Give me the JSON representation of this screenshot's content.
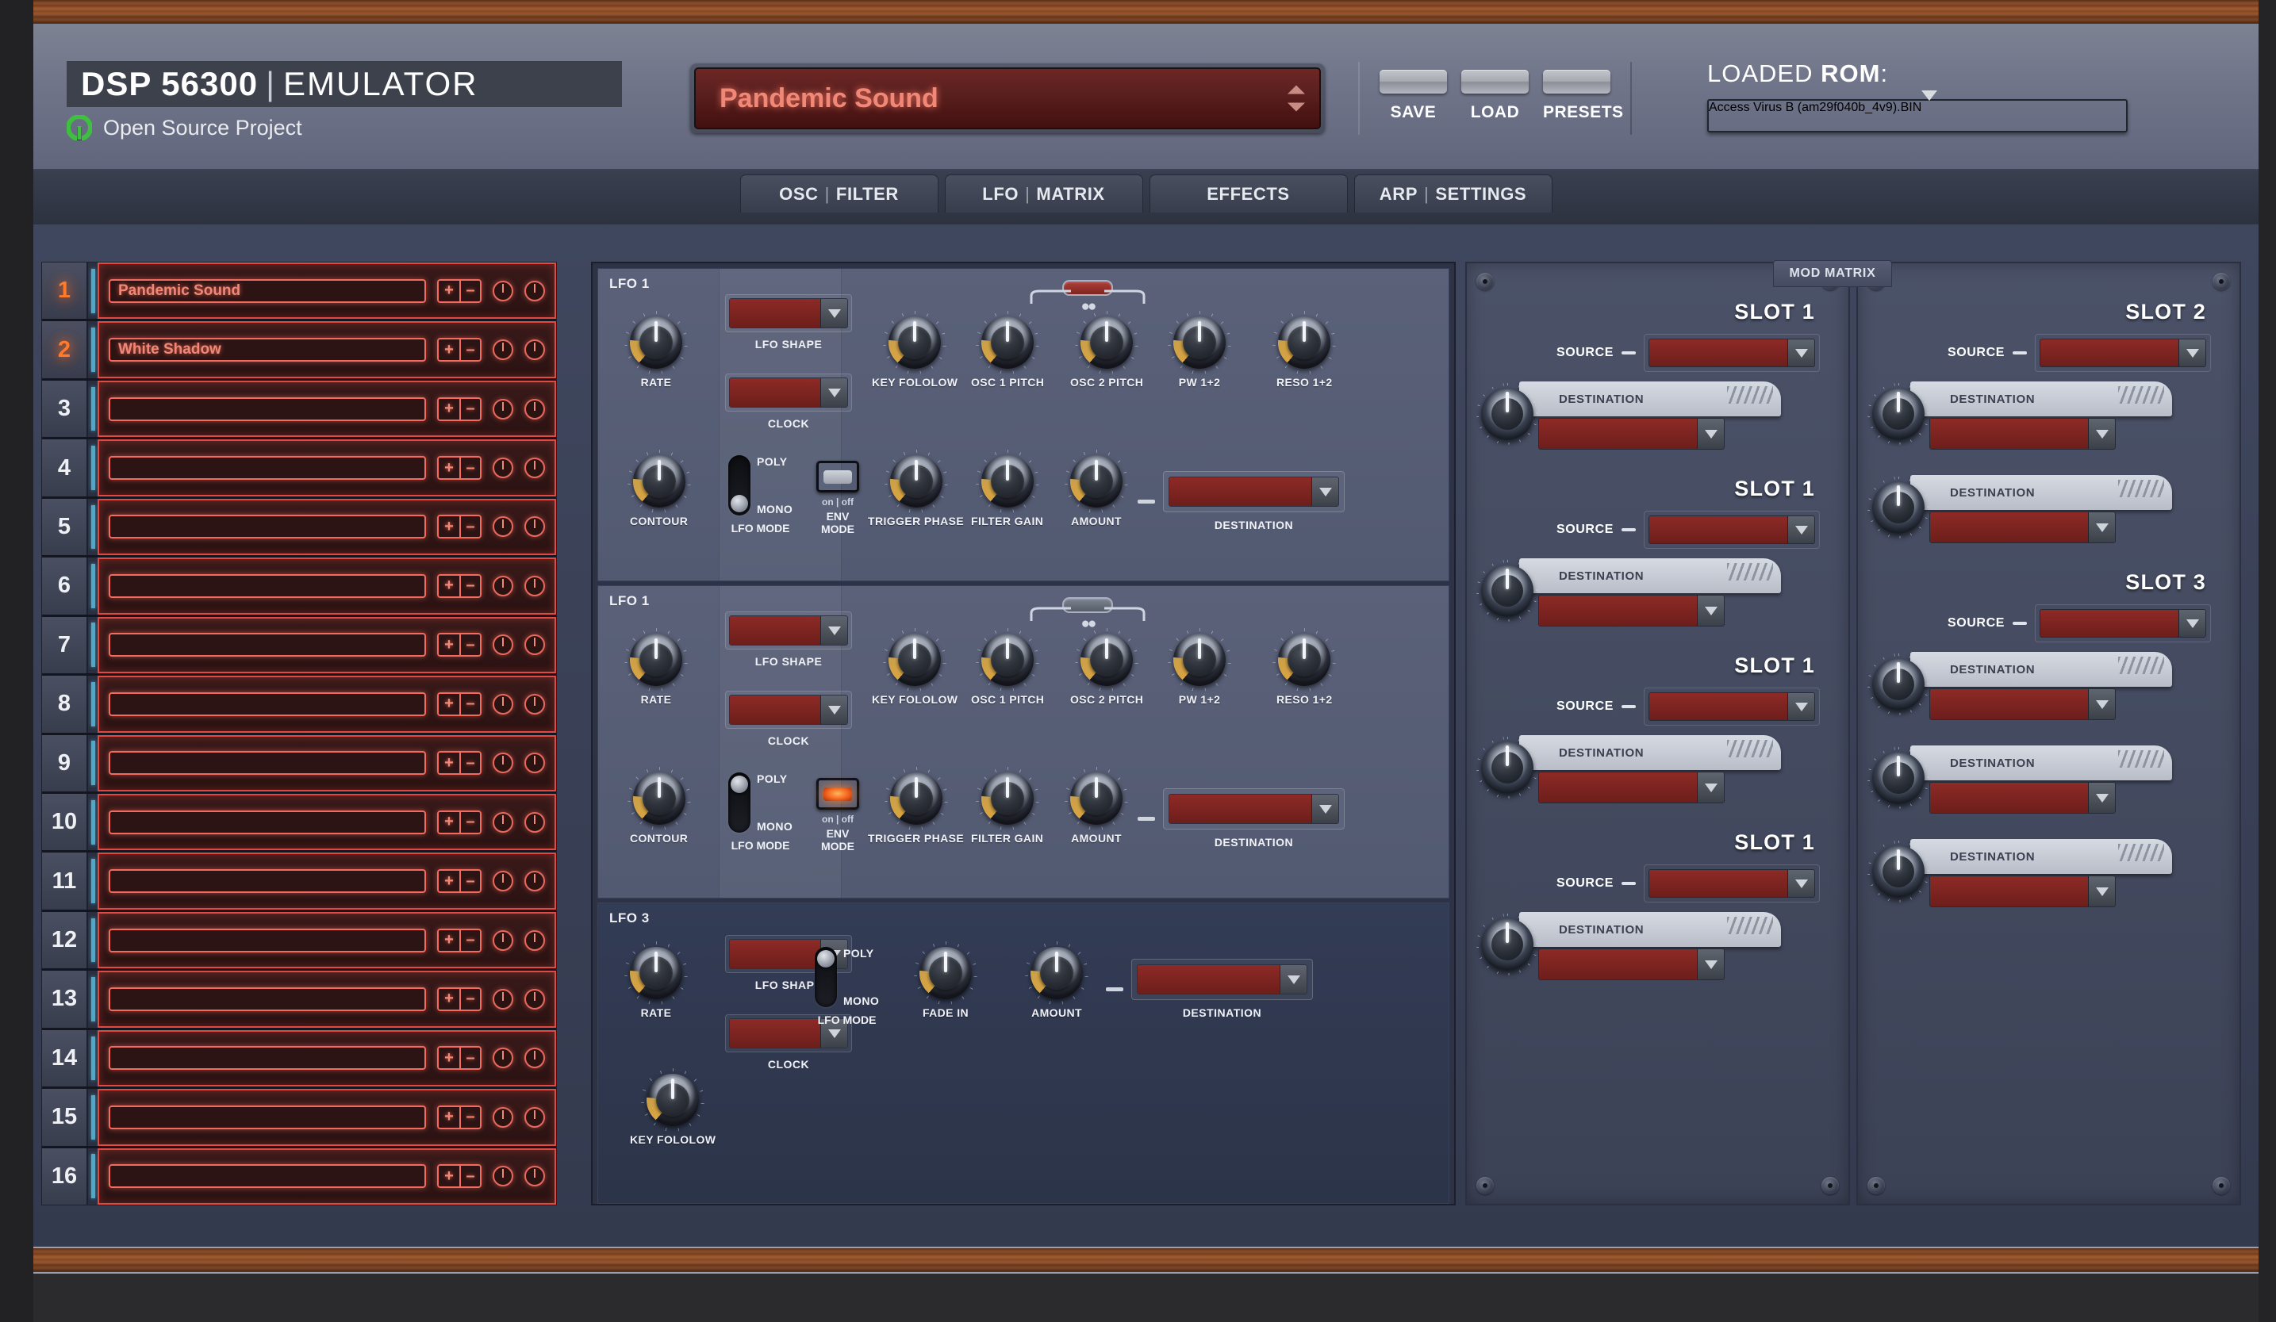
{
  "app": {
    "logo_main": "DSP 56300",
    "logo_sep": "|",
    "logo_sub": "EMULATOR",
    "open_source": "Open Source Project"
  },
  "header": {
    "patch_name": "Pandemic Sound",
    "buttons": [
      {
        "label": "SAVE",
        "name": "save-button"
      },
      {
        "label": "LOAD",
        "name": "load-button"
      },
      {
        "label": "PRESETS",
        "name": "presets-button"
      }
    ],
    "rom_label_a": "LOADED ",
    "rom_label_b": "ROM",
    "rom_label_c": ":",
    "rom_value": "Access Virus B (am29f040b_4v9).BIN"
  },
  "tabs": [
    {
      "left": "OSC",
      "right": "FILTER",
      "active": false
    },
    {
      "left": "LFO",
      "right": "MATRIX",
      "active": true
    },
    {
      "left": "EFFECTS",
      "right": "",
      "active": false
    },
    {
      "left": "ARP",
      "right": "SETTINGS",
      "active": false
    }
  ],
  "patch_list": {
    "plus_label": "+",
    "minus_label": "–",
    "rows": [
      {
        "num": "1",
        "name": "Pandemic Sound",
        "lit": true
      },
      {
        "num": "2",
        "name": "White Shadow",
        "lit": true
      },
      {
        "num": "3",
        "name": "",
        "lit": false
      },
      {
        "num": "4",
        "name": "",
        "lit": false
      },
      {
        "num": "5",
        "name": "",
        "lit": false
      },
      {
        "num": "6",
        "name": "",
        "lit": false
      },
      {
        "num": "7",
        "name": "",
        "lit": false
      },
      {
        "num": "8",
        "name": "",
        "lit": false
      },
      {
        "num": "9",
        "name": "",
        "lit": false
      },
      {
        "num": "10",
        "name": "",
        "lit": false
      },
      {
        "num": "11",
        "name": "",
        "lit": false
      },
      {
        "num": "12",
        "name": "",
        "lit": false
      },
      {
        "num": "13",
        "name": "",
        "lit": false
      },
      {
        "num": "14",
        "name": "",
        "lit": false
      },
      {
        "num": "15",
        "name": "",
        "lit": false
      },
      {
        "num": "16",
        "name": "",
        "lit": false
      }
    ]
  },
  "lfo1": {
    "title": "LFO 1",
    "rate": "RATE",
    "contour": "CONTOUR",
    "shape": "LFO SHAPE",
    "clock": "CLOCK",
    "mode": "LFO MODE",
    "mode_poly": "POLY",
    "mode_mono": "MONO",
    "mode_state": "mono",
    "env_sub": "on | off",
    "env_cap_a": "ENV",
    "env_cap_b": "MODE",
    "env_state": "off",
    "key_fololow": "KEY FOLOLOW",
    "osc1_pitch": "OSC 1 PITCH",
    "osc2_pitch": "OSC 2 PITCH",
    "pw": "PW 1+2",
    "reso": "RESO 1+2",
    "trigger_phase": "TRIGGER PHASE",
    "filter_gain": "FILTER GAIN",
    "amount": "AMOUNT",
    "destination": "DESTINATION"
  },
  "lfo2": {
    "title": "LFO 1",
    "rate": "RATE",
    "contour": "CONTOUR",
    "shape": "LFO SHAPE",
    "clock": "CLOCK",
    "mode": "LFO MODE",
    "mode_poly": "POLY",
    "mode_mono": "MONO",
    "mode_state": "poly",
    "env_sub": "on | off",
    "env_cap_a": "ENV",
    "env_cap_b": "MODE",
    "env_state": "on",
    "key_fololow": "KEY FOLOLOW",
    "osc1_pitch": "OSC 1 PITCH",
    "osc2_pitch": "OSC 2 PITCH",
    "pw": "PW 1+2",
    "reso": "RESO 1+2",
    "trigger_phase": "TRIGGER PHASE",
    "filter_gain": "FILTER GAIN",
    "amount": "AMOUNT",
    "destination": "DESTINATION"
  },
  "lfo3": {
    "title": "LFO 3",
    "rate": "RATE",
    "key_fololow": "KEY FOLOLOW",
    "shape": "LFO SHAPE",
    "clock": "CLOCK",
    "mode": "LFO MODE",
    "mode_poly": "POLY",
    "mode_mono": "MONO",
    "mode_state": "poly",
    "fade_in": "FADE IN",
    "amount": "AMOUNT",
    "destination": "DESTINATION"
  },
  "mod_matrix": {
    "tab_label": "MOD MATRIX",
    "source_label": "SOURCE",
    "destination_label": "DESTINATION",
    "left_column": [
      {
        "slot": "SLOT 1",
        "destinations": 1
      },
      {
        "slot": "SLOT 1",
        "destinations": 1
      },
      {
        "slot": "SLOT 1",
        "destinations": 1
      },
      {
        "slot": "SLOT 1",
        "destinations": 1
      }
    ],
    "right_column": [
      {
        "slot": "SLOT 2",
        "destinations": 2
      },
      {
        "slot": "SLOT 3",
        "destinations": 3
      }
    ]
  },
  "colors": {
    "red_display": "#7d2321",
    "red_text": "#f08878",
    "led_on": "#f1621d",
    "accent_blue": "#4fa8c8",
    "panel": "#5a6179"
  }
}
